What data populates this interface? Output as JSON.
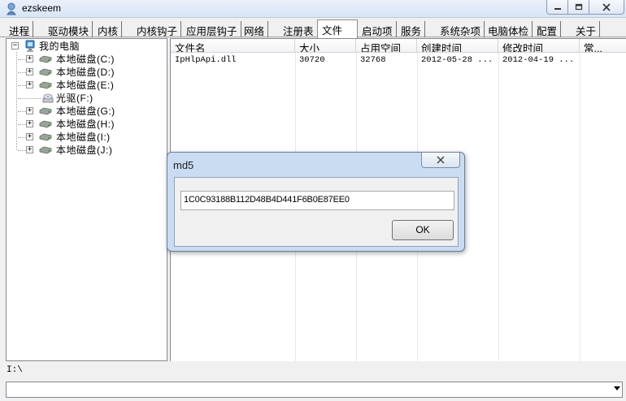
{
  "window": {
    "title": "ezskeem"
  },
  "tabs": [
    {
      "label": "进程"
    },
    {
      "label": "驱动模块"
    },
    {
      "label": "内核"
    },
    {
      "label": "内核钩子"
    },
    {
      "label": "应用层钩子"
    },
    {
      "label": "网络"
    },
    {
      "label": "注册表"
    },
    {
      "label": "文件"
    },
    {
      "label": "启动项"
    },
    {
      "label": "服务"
    },
    {
      "label": "系统杂项"
    },
    {
      "label": "电脑体检"
    },
    {
      "label": "配置"
    },
    {
      "label": "关于"
    }
  ],
  "active_tab": "文件",
  "tree": {
    "root": "我的电脑",
    "items": [
      {
        "label": "本地磁盘(C:)",
        "icon": "hard-drive-icon",
        "expandable": true
      },
      {
        "label": "本地磁盘(D:)",
        "icon": "hard-drive-icon",
        "expandable": true
      },
      {
        "label": "本地磁盘(E:)",
        "icon": "hard-drive-icon",
        "expandable": true
      },
      {
        "label": "光驱(F:)",
        "icon": "optical-drive-icon",
        "expandable": false
      },
      {
        "label": "本地磁盘(G:)",
        "icon": "hard-drive-icon",
        "expandable": true
      },
      {
        "label": "本地磁盘(H:)",
        "icon": "hard-drive-icon",
        "expandable": true
      },
      {
        "label": "本地磁盘(I:)",
        "icon": "hard-drive-icon",
        "expandable": true
      },
      {
        "label": "本地磁盘(J:)",
        "icon": "hard-drive-icon",
        "expandable": true
      }
    ]
  },
  "file_list": {
    "columns": [
      "文件名",
      "大小",
      "占用空间",
      "创建时间",
      "修改时间",
      "常..."
    ],
    "rows": [
      [
        "IpHlpApi.dll",
        "30720",
        "32768",
        "2012-05-28 ...",
        "2012-04-19 ...",
        ""
      ]
    ]
  },
  "path_bar": "I:\\",
  "dialog": {
    "title": "md5",
    "value": "1C0C93188B112D48B4D441F6B0E87EE0",
    "ok_label": "OK"
  },
  "colors": {
    "dialog_frame": "#c9dcf2",
    "titlebar": "#dbe7f6"
  }
}
